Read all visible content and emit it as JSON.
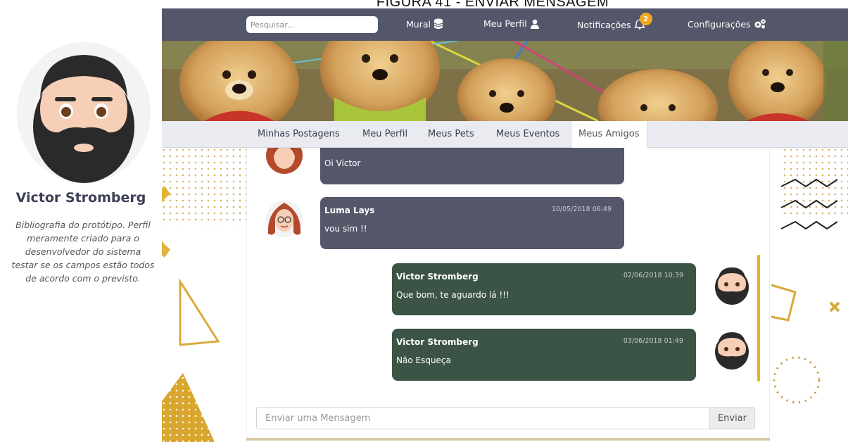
{
  "figure_caption": "FIGURA 41 - ENVIAR MENSAGEM",
  "profile": {
    "name": "Victor Stromberg",
    "bio": "Bibliografia do protótipo. Perfil meramente criado para o desenvolvedor do sistema testar se os campos estão todos de acordo com o previsto."
  },
  "topbar": {
    "search_placeholder": "Pesquisar...",
    "nav": [
      {
        "label": "Mural",
        "icon": "database-icon"
      },
      {
        "label": "Meu Perfil",
        "icon": "user-icon"
      },
      {
        "label": "Notificações",
        "icon": "bell-icon",
        "badge": "2"
      },
      {
        "label": "Configurações",
        "icon": "gears-icon"
      }
    ]
  },
  "tabs": [
    "Minhas Postagens",
    "Meu Perfil",
    "Meus Pets",
    "Meus Eventos",
    "Meus Amigos"
  ],
  "active_tab": "Meus Amigos",
  "messages": [
    {
      "author": "",
      "time": "",
      "text": "Oi Victor",
      "side": "recv"
    },
    {
      "author": "Luma Lays",
      "time": "10/05/2018 06:49",
      "text": "vou sim !!",
      "side": "recv"
    },
    {
      "author": "Victor Stromberg",
      "time": "02/06/2018 10:39",
      "text": "Que bom, te aguardo lá !!!",
      "side": "sent"
    },
    {
      "author": "Victor Stromberg",
      "time": "03/06/2018 01:49",
      "text": "Não Esqueça",
      "side": "sent"
    }
  ],
  "composer": {
    "placeholder": "Enviar uma Mensagem",
    "send_label": "Enviar"
  },
  "colors": {
    "nav_bg": "#545769",
    "received_bubble": "#545769",
    "sent_bubble": "#3b5446",
    "accent_gold": "#e8b21c",
    "badge": "#f2a81d"
  }
}
